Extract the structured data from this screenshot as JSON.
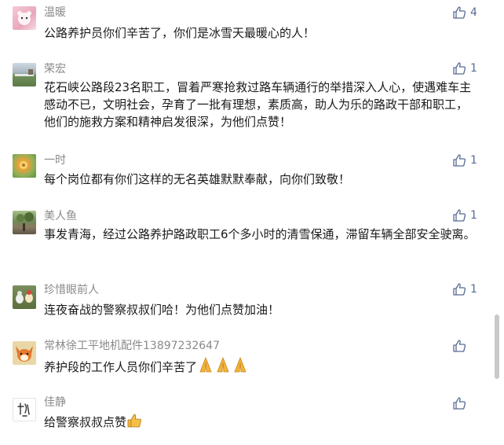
{
  "comments": [
    {
      "name": "温暖",
      "text": "公路养护员你们辛苦了，你们是冰雪天最暖心的人！",
      "likes": "4",
      "avatar": "avatar-photo-pink-bear"
    },
    {
      "name": "荣宏",
      "text": "花石峡公路段23名职工，冒着严寒抢救过路车辆通行的举措深入人心，使遇难车主感动不已，文明社会，孕育了一批有理想，素质高，助人为乐的路政干部和职工，他们的施救方案和精神启发很深，为他们点赞！",
      "likes": "1",
      "avatar": "avatar-photo-landscape"
    },
    {
      "name": "一时",
      "text": "每个岗位都有你们这样的无名英雄默默奉献，向你们致敬！",
      "likes": "1",
      "avatar": "avatar-photo-flower"
    },
    {
      "name": "美人鱼",
      "text": "事发青海，经过公路养护路政职工6个多小时的清雪保通，滞留车辆全部安全驶离。",
      "likes": "1",
      "avatar": "avatar-photo-garden"
    },
    {
      "name": "珍惜眼前人",
      "text": "连夜奋战的警察叔叔们哈！为他们点赞加油！",
      "likes": "1",
      "avatar": "avatar-photo-ducks"
    },
    {
      "name": "常林徐工平地机配件13897232647",
      "text": "养护段的工作人员你们辛苦了",
      "likes": "",
      "avatar": "avatar-illustration-fox",
      "emoji": "pray-emoji"
    },
    {
      "name": "佳静",
      "text": "给警察叔叔点赞",
      "likes": "",
      "avatar": "avatar-calligraphy",
      "emoji": "thumbs-up-emoji"
    }
  ],
  "icons": {
    "like": "thumbs-up-icon"
  },
  "colors": {
    "name": "#8a8a8a",
    "text": "#1a1a1a",
    "like": "#576b95",
    "scrollbar": "#c9c9c9"
  }
}
